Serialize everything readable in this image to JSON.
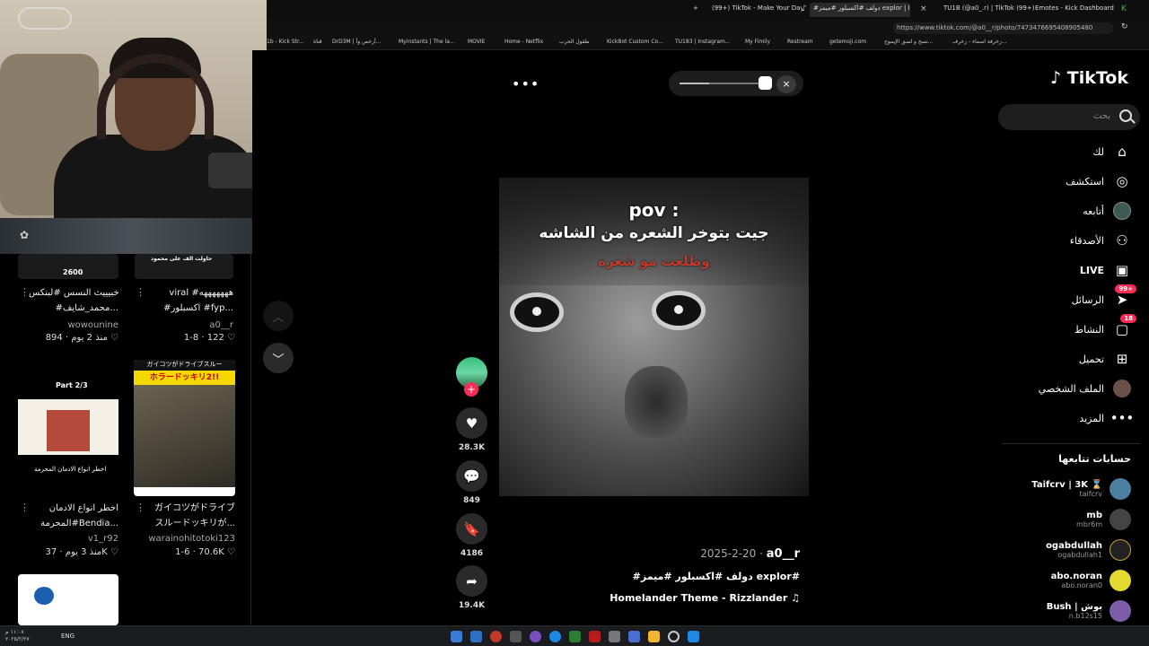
{
  "browser": {
    "tabs": [
      {
        "label": "(99+) TikTok - Make Your Day",
        "active": false
      },
      {
        "label": "#دولف #اكسبلور #ميمز explor | ا...",
        "active": true
      },
      {
        "label": "TU1B (@a0_.r) | TikTok (99+)",
        "active": false
      },
      {
        "label": "Emotes - Kick Dashboard",
        "active": false
      }
    ],
    "new_tab": "+",
    "url": "https://www.tiktok.com/@a0__r/photo/7473476695408905480",
    "bookmarks": [
      "1b - Kick Str...",
      "قناة",
      "DrD3M | أرخص وأ...",
      "Myinstants | The la...",
      "MOVIE",
      "Home - Netflix",
      "طقول الحرب",
      "KickBot Custom Co...",
      "TU183 | Instagram...",
      "My Fimily",
      "Restream",
      "getemoji.com",
      "نسخ و لصق الإيموج...",
      "زخرفة اسماء - زخرف..."
    ]
  },
  "left_grid": {
    "top_badge": "2600",
    "top_right_caption": "حاولت الف على محمود",
    "cards": [
      {
        "title_line1": "خبيييث النسس #لبنكس",
        "title_line2": "#محمد_شايف...",
        "author": "wowounine",
        "likes": "894",
        "age": "منذ 2 يوم"
      },
      {
        "title_line1": "viral #هههههههه",
        "title_line2": "#اكسبلور #fyp...",
        "author": "a0__r",
        "likes": "122",
        "age": "1-8"
      },
      {
        "title_line1": "اخطر انواع الادمان",
        "title_line2": "المحرمة#Bendia...",
        "author": "v1_r92",
        "likes": "37K",
        "age": "منذ 3 يوم",
        "badge": "Part 2/3",
        "inner_caption": "اخطر انواع الادمان المحرمة"
      },
      {
        "title_line1": "ガイコツがドライブ",
        "title_line2": "スルードッキリが...",
        "author": "warainohitotoki123",
        "likes": "70.6K",
        "age": "1-6",
        "thumb_caption_1": "ガイコツがドライブスルー",
        "thumb_caption_2": "ホラードッキリ2!!"
      }
    ]
  },
  "player": {
    "more_label": "•••",
    "close_label": "×",
    "volume_fraction": 0.35,
    "caption_pov": "pov :",
    "caption_ar": "جيت بتوخر الشعره من الشاشه",
    "caption_red": "وطلعت مو شعره",
    "likes": "28.3K",
    "comments": "849",
    "saves": "4186",
    "shares": "19.4K",
    "date": "2025-2-20",
    "author": "a0__r",
    "hashtags": "#دولف #اكسبلور #ميمز explor#",
    "music": "Homelander Theme - Rizzlander",
    "up_icon": "chevron-up-icon",
    "down_icon": "chevron-down-icon"
  },
  "sidebar": {
    "logo": "TikTok",
    "search_placeholder": "بحث",
    "nav": [
      {
        "label": "لك",
        "icon": "home-icon"
      },
      {
        "label": "استكشف",
        "icon": "compass-icon"
      },
      {
        "label": "أتابعه",
        "icon": "avatar-icon"
      },
      {
        "label": "الأصدقاء",
        "icon": "friends-icon"
      },
      {
        "label": "LIVE",
        "icon": "live-icon"
      },
      {
        "label": "الرسائل",
        "icon": "messages-icon",
        "badge": "99+"
      },
      {
        "label": "النشاط",
        "icon": "activity-icon",
        "badge": "18"
      },
      {
        "label": "تحميل",
        "icon": "upload-icon"
      },
      {
        "label": "الملف الشخصي",
        "icon": "profile-icon"
      },
      {
        "label": "المزيد",
        "icon": "more-icon"
      }
    ],
    "following_title": "حسابات تتابعها",
    "accounts": [
      {
        "name": "Taifcrv | 3K ⌛",
        "handle": "taifcrv",
        "color": "#4b7fa0"
      },
      {
        "name": "mb",
        "handle": "mbr6m",
        "color": "#444"
      },
      {
        "name": "ogabdullah",
        "handle": "ogabdullah1",
        "color": "#222"
      },
      {
        "name": "abo.noran",
        "handle": "abo.noran0",
        "color": "#e5d830"
      },
      {
        "name": "Bush | بوش",
        "handle": "n.b12s15",
        "color": "#7b5ea7"
      }
    ]
  },
  "taskbar": {
    "time": "١١:٠٨ م",
    "date": "٢٠٢٥/٢/٢٧",
    "lang": "ENG"
  },
  "colors": {
    "accent": "#fe2c55",
    "caption_red": "#c0392b"
  }
}
